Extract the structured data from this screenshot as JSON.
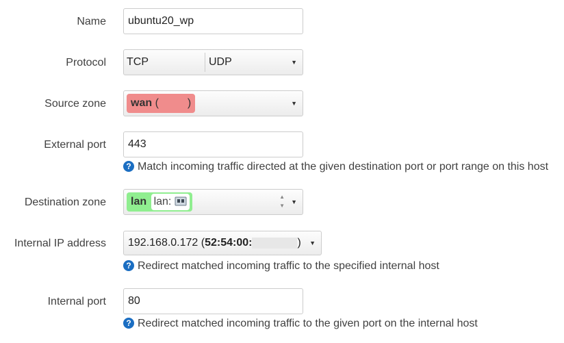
{
  "form": {
    "name": {
      "label": "Name",
      "value": "ubuntu20_wp"
    },
    "protocol": {
      "label": "Protocol",
      "options": [
        "TCP",
        "UDP"
      ]
    },
    "source_zone": {
      "label": "Source zone",
      "zone_name": "wan",
      "zone_suffix_open": "(",
      "zone_suffix_close": ")",
      "color": "#f08c8c"
    },
    "external_port": {
      "label": "External port",
      "value": "443",
      "help": "Match incoming traffic directed at the given destination port or port range on this host"
    },
    "destination_zone": {
      "label": "Destination zone",
      "zone_name": "lan",
      "network_label": "lan:",
      "color": "#90ee90"
    },
    "internal_ip": {
      "label": "Internal IP address",
      "value": "192.168.0.172",
      "mac_prefix": "52:54:00:",
      "help": "Redirect matched incoming traffic to the specified internal host"
    },
    "internal_port": {
      "label": "Internal port",
      "value": "80",
      "help": "Redirect matched incoming traffic to the given port on the internal host"
    }
  },
  "icons": {
    "help": "question-circle-icon",
    "network": "ethernet-port-icon",
    "dropdown": "triangle-down-icon"
  },
  "colors": {
    "help_icon": "#1b6ec2"
  }
}
